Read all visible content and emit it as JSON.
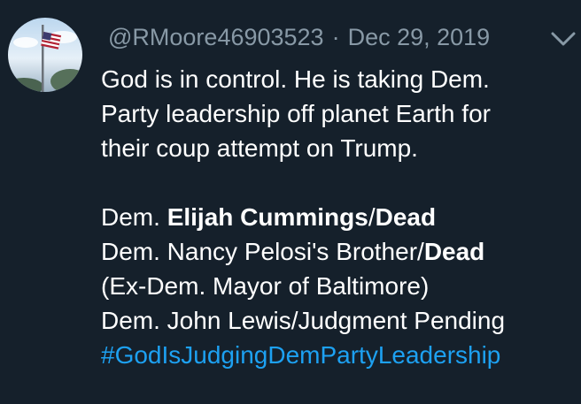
{
  "tweet": {
    "handle": "@RMoore46903523",
    "separator": "·",
    "date": "Dec 29, 2019",
    "lines": [
      "God is in control. He is taking Dem.",
      "Party leadership off planet Earth for",
      "their coup attempt on Trump."
    ],
    "list": {
      "l1_prefix": "Dem. ",
      "l1_name": "Elijah Cummings",
      "l1_sep": "/",
      "l1_status": "Dead",
      "l2_prefix": "Dem. Nancy Pelosi's Brother/",
      "l2_status": "Dead",
      "l3": "(Ex-Dem. Mayor of Baltimore)",
      "l4": "Dem. John Lewis/Judgment Pending"
    },
    "hashtag": "#GodIsJudgingDemPartyLeadership"
  },
  "colors": {
    "background": "#15202b",
    "text": "#ffffff",
    "muted": "#8899a6",
    "link": "#1da1f2"
  },
  "icons": {
    "menu": "chevron-down-icon"
  }
}
